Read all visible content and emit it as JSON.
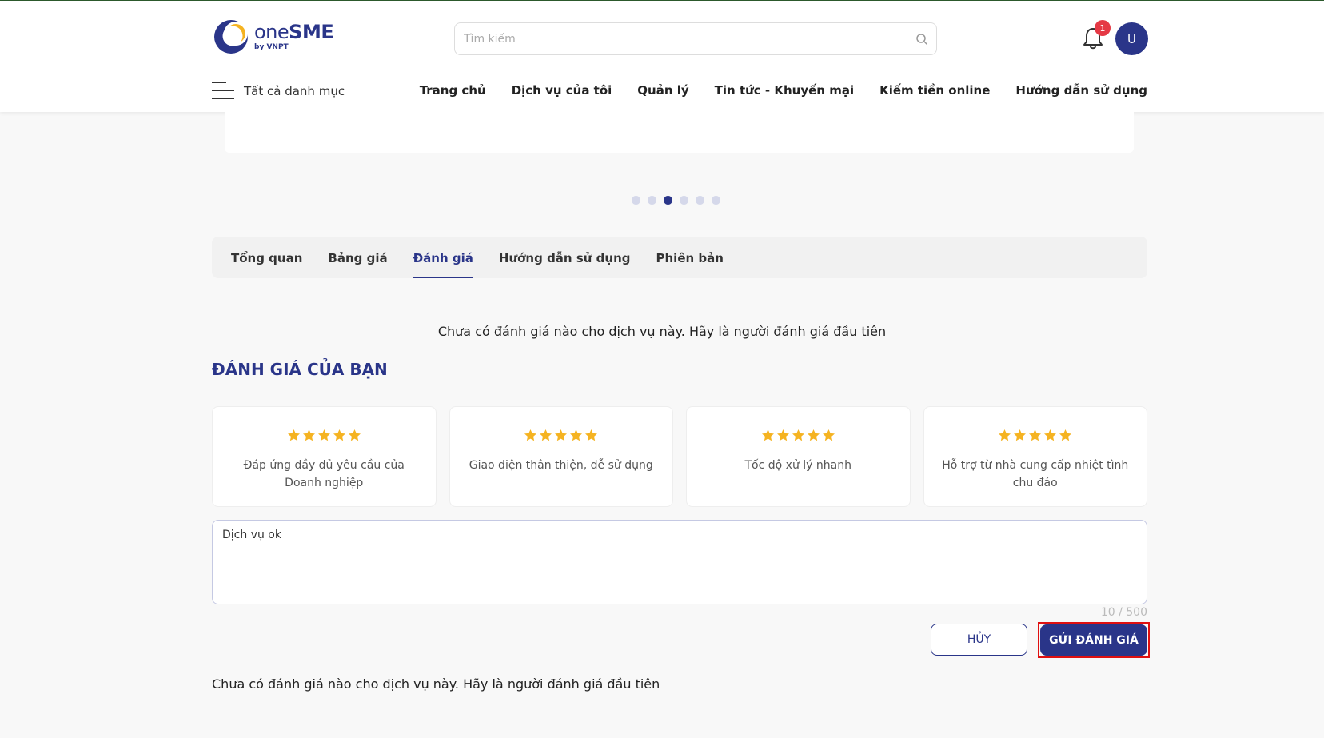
{
  "header": {
    "logo_name_prefix": "one",
    "logo_name_suffix": "SME",
    "logo_sub": "by VNPT",
    "search_placeholder": "Tìm kiếm",
    "notification_count": "1",
    "avatar_initial": "U",
    "menu_label": "Tất cả danh mục",
    "nav": [
      {
        "label": "Trang chủ"
      },
      {
        "label": "Dịch vụ của tôi"
      },
      {
        "label": "Quản lý"
      },
      {
        "label": "Tin tức - Khuyến mại"
      },
      {
        "label": "Kiếm tiền online"
      },
      {
        "label": "Hướng dẫn sử dụng"
      }
    ]
  },
  "carousel": {
    "dot_count": 6,
    "active_index": 2
  },
  "tabs": [
    {
      "label": "Tổng quan",
      "active": false
    },
    {
      "label": "Bảng giá",
      "active": false
    },
    {
      "label": "Đánh giá",
      "active": true
    },
    {
      "label": "Hướng dẫn sử dụng",
      "active": false
    },
    {
      "label": "Phiên bản",
      "active": false
    }
  ],
  "review": {
    "empty_message": "Chưa có đánh giá nào cho dịch vụ này. Hãy là người đánh giá đầu tiên",
    "section_title": "ĐÁNH GIÁ CỦA BẠN",
    "criteria": [
      {
        "label": "Đáp ứng đầy đủ yêu cầu của Doanh nghiệp",
        "rating": 5,
        "max": 5
      },
      {
        "label": "Giao diện thân thiện, dễ sử dụng",
        "rating": 5,
        "max": 5
      },
      {
        "label": "Tốc độ xử lý nhanh",
        "rating": 5,
        "max": 5
      },
      {
        "label": "Hỗ trợ từ nhà cung cấp nhiệt tình chu đáo",
        "rating": 5,
        "max": 5
      }
    ],
    "comment_value": "Dịch vụ ok",
    "char_counter": "10 / 500",
    "cancel_label": "HỦY",
    "submit_label": "GỬI ĐÁNH GIÁ",
    "bottom_message": "Chưa có đánh giá nào cho dịch vụ này. Hãy là người đánh giá đầu tiên"
  },
  "colors": {
    "brand": "#2a3589",
    "star": "#f5b321",
    "badge": "#e53945",
    "highlight_frame": "#e01010"
  }
}
